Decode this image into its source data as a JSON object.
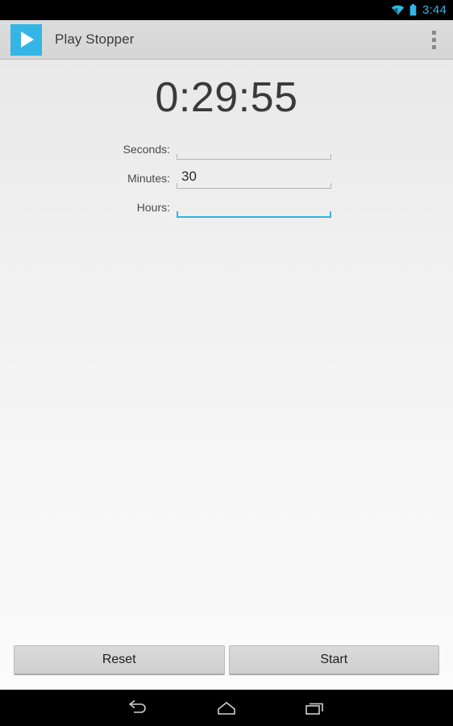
{
  "status_bar": {
    "time": "3:44",
    "wifi_icon": "wifi-icon",
    "battery_icon": "battery-icon",
    "accent_color": "#33b5e5"
  },
  "action_bar": {
    "app_icon": "play-triangle-icon",
    "app_icon_color": "#33b5e5",
    "title": "Play Stopper",
    "overflow_icon": "overflow-menu-icon"
  },
  "main": {
    "timer": "0:29:55",
    "fields": [
      {
        "label": "Seconds:",
        "value": "",
        "focused": false
      },
      {
        "label": "Minutes:",
        "value": "30",
        "focused": false
      },
      {
        "label": "Hours:",
        "value": "",
        "focused": true
      }
    ],
    "focus_color": "#33b5e5"
  },
  "buttons": {
    "reset_label": "Reset",
    "start_label": "Start"
  },
  "nav_bar": {
    "back_icon": "back-arrow-icon",
    "home_icon": "home-icon",
    "recents_icon": "recents-icon"
  }
}
